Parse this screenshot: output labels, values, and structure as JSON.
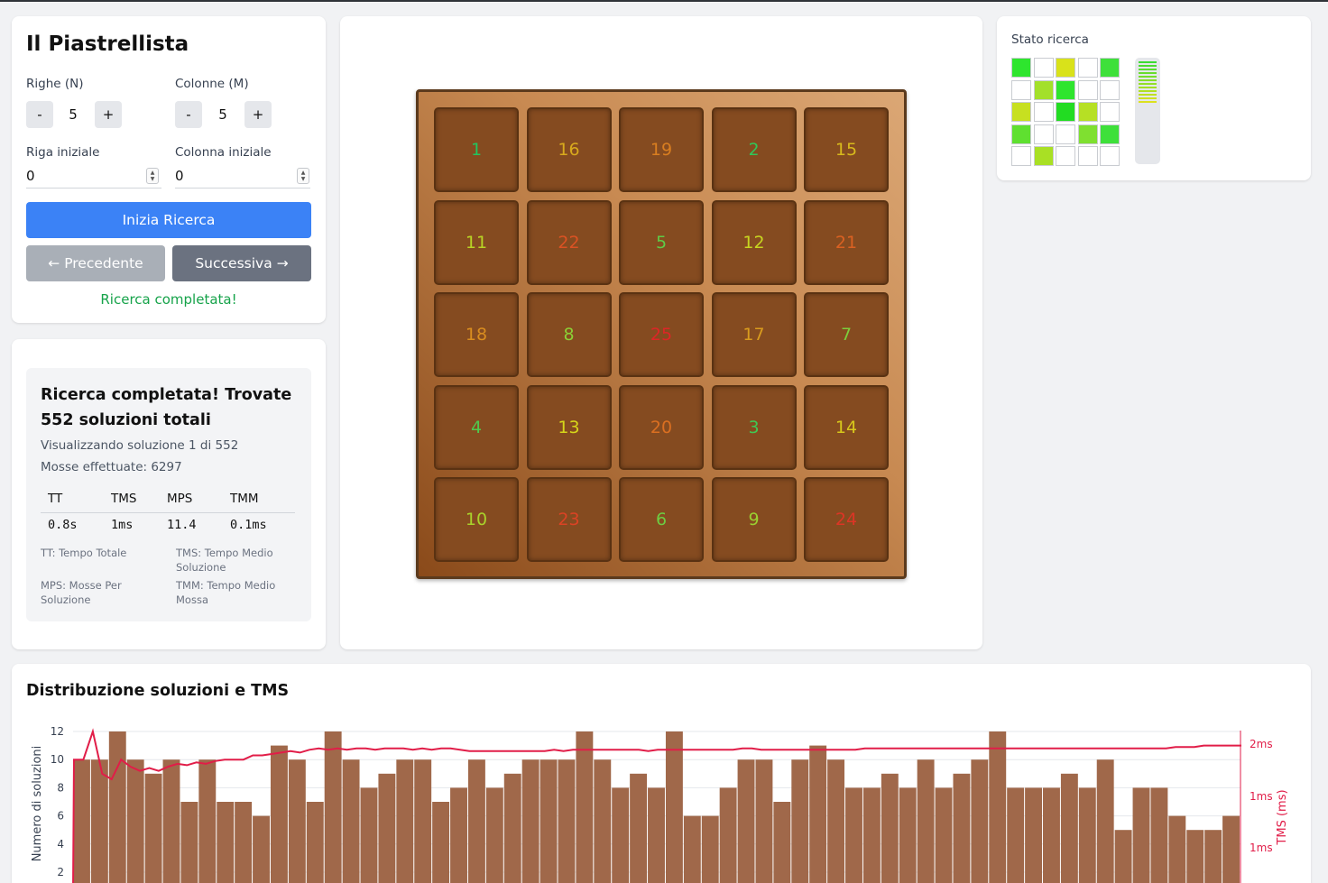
{
  "controls": {
    "title": "Il Piastrellista",
    "rows_label": "Righe (N)",
    "cols_label": "Colonne (M)",
    "rows_value": "5",
    "cols_value": "5",
    "minus": "-",
    "plus": "+",
    "start_row_label": "Riga iniziale",
    "start_col_label": "Colonna iniziale",
    "start_row_value": "0",
    "start_col_value": "0",
    "start_button": "Inizia Ricerca",
    "prev_button": "← Precedente",
    "next_button": "Successiva →",
    "status": "Ricerca completata!",
    "colors": {
      "primary": "#3b82f6",
      "prev_disabled": "#a9afb7",
      "next": "#6b7280",
      "success": "#16a34a"
    }
  },
  "stats": {
    "heading": "Ricerca completata! Trovate 552 soluzioni totali",
    "viewing": "Visualizzando soluzione 1 di 552",
    "moves": "Mosse effettuate: 6297",
    "headers": [
      "TT",
      "TMS",
      "MPS",
      "TMM"
    ],
    "values": [
      "0.8s",
      "1ms",
      "11.4",
      "0.1ms"
    ],
    "legend": [
      "TT: Tempo Totale",
      "TMS: Tempo Medio Soluzione",
      "MPS: Mosse Per Soluzione",
      "TMM: Tempo Medio Mossa"
    ]
  },
  "board": {
    "tiles": [
      [
        1,
        16,
        19,
        2,
        15
      ],
      [
        11,
        22,
        5,
        12,
        21
      ],
      [
        18,
        8,
        25,
        17,
        7
      ],
      [
        4,
        13,
        20,
        3,
        14
      ],
      [
        10,
        23,
        6,
        9,
        24
      ]
    ],
    "max": 25,
    "colors": {
      "low": "#22c55e",
      "mid": "#d6d61a",
      "high": "#dc2626"
    }
  },
  "search_state": {
    "title": "Stato ricerca",
    "grid": [
      [
        "#2ee52e",
        "#ffffff",
        "#d9e21a",
        "#ffffff",
        "#3ee03a"
      ],
      [
        "#ffffff",
        "#a3e02a",
        "#2ee52e",
        "#ffffff",
        "#ffffff"
      ],
      [
        "#c7e020",
        "#ffffff",
        "#22dc22",
        "#b6e024",
        "#ffffff"
      ],
      [
        "#5fe030",
        "#ffffff",
        "#ffffff",
        "#7fe030",
        "#3ee03a"
      ],
      [
        "#ffffff",
        "#a9e024",
        "#ffffff",
        "#ffffff",
        "#ffffff"
      ]
    ],
    "progress": 0.46
  },
  "chart_data": {
    "type": "bar",
    "title": "Distribuzione soluzioni e TMS",
    "ylabel": "Numero di soluzioni",
    "y2label": "TMS (ms)",
    "ylim_visible": [
      2,
      12
    ],
    "yticks": [
      2,
      4,
      6,
      8,
      10,
      12
    ],
    "y2ticks": [
      "2ms",
      "1ms",
      "1ms"
    ],
    "bar_color": "#a0684a",
    "line_color": "#e11d48",
    "values": [
      10,
      10,
      12,
      10,
      9,
      10,
      7,
      10,
      7,
      7,
      6,
      11,
      10,
      7,
      12,
      10,
      8,
      9,
      10,
      10,
      7,
      8,
      10,
      8,
      9,
      10,
      10,
      10,
      12,
      10,
      8,
      9,
      8,
      12,
      6,
      6,
      8,
      10,
      10,
      7,
      10,
      11,
      10,
      8,
      8,
      9,
      8,
      10,
      8,
      9,
      10,
      12,
      8,
      8,
      8,
      9,
      8,
      10,
      5,
      8,
      8,
      6,
      5,
      5,
      6
    ],
    "tms_line": [
      10,
      10,
      12,
      9,
      8.6,
      10,
      9.5,
      9.2,
      9.4,
      9.2,
      9.5,
      9.7,
      9.6,
      9.8,
      9.7,
      9.9,
      10,
      10,
      10,
      10.3,
      10.3,
      10.4,
      10.5,
      10.6,
      10.5,
      10.7,
      10.8,
      10.7,
      10.8,
      10.7,
      10.8,
      10.8,
      10.7,
      10.8,
      10.8,
      10.8,
      10.7,
      10.8,
      10.7,
      10.8,
      10.8,
      10.7,
      10.6,
      10.6,
      10.6,
      10.6,
      10.6,
      10.6,
      10.6,
      10.6,
      10.6,
      10.7,
      10.6,
      10.7,
      10.7,
      10.7,
      10.7,
      10.7,
      10.7,
      10.7,
      10.7,
      10.6,
      10.7,
      10.7,
      10.7,
      10.7,
      10.7,
      10.7,
      10.7,
      10.7,
      10.7,
      10.8,
      10.8,
      10.7,
      10.7,
      10.7,
      10.7,
      10.7,
      10.7,
      10.7,
      10.7,
      10.7,
      10.7,
      10.7,
      10.8,
      10.8,
      10.8,
      10.8,
      10.8,
      10.8,
      10.8,
      10.8,
      10.8,
      10.8,
      10.8,
      10.8,
      10.8,
      10.8,
      10.8,
      10.8,
      10.8,
      10.8,
      10.8,
      10.8,
      10.8,
      10.8,
      10.8,
      10.8,
      10.8,
      10.8,
      10.8,
      10.8,
      10.8,
      10.8,
      10.8,
      10.8,
      10.8,
      10.9,
      10.9,
      10.9,
      11,
      11,
      11,
      11,
      11
    ]
  }
}
